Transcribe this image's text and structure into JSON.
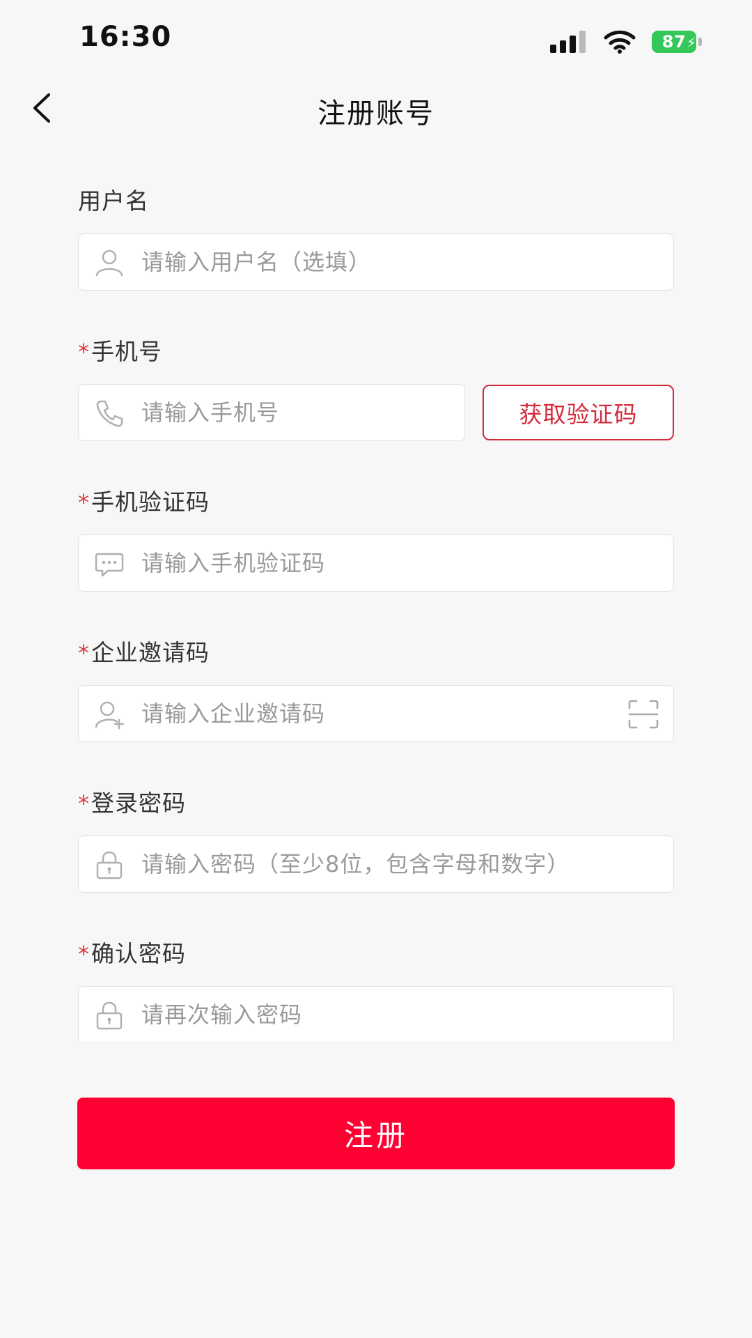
{
  "status_bar": {
    "time": "16:30",
    "battery": "87"
  },
  "header": {
    "title": "注册账号"
  },
  "form": {
    "username": {
      "label": "用户名",
      "placeholder": "请输入用户名（选填）"
    },
    "phone": {
      "required_mark": "*",
      "label": "手机号",
      "placeholder": "请输入手机号",
      "get_code_label": "获取验证码"
    },
    "sms_code": {
      "required_mark": "*",
      "label": "手机验证码",
      "placeholder": "请输入手机验证码"
    },
    "invite_code": {
      "required_mark": "*",
      "label": "企业邀请码",
      "placeholder": "请输入企业邀请码"
    },
    "password": {
      "required_mark": "*",
      "label": "登录密码",
      "placeholder": "请输入密码（至少8位，包含字母和数字）"
    },
    "confirm_password": {
      "required_mark": "*",
      "label": "确认密码",
      "placeholder": "请再次输入密码"
    },
    "submit_label": "注册"
  },
  "icons": {
    "back": "chevron-left-icon",
    "username": "user-icon",
    "phone": "phone-icon",
    "sms_code": "chat-icon",
    "invite_code": "user-plus-icon",
    "scan": "scan-icon",
    "password": "lock-icon",
    "confirm_password": "lock-icon"
  },
  "colors": {
    "accent": "#ff0032",
    "accent_border": "#d42a3c",
    "required": "#e03a3a",
    "battery": "#34c759"
  }
}
